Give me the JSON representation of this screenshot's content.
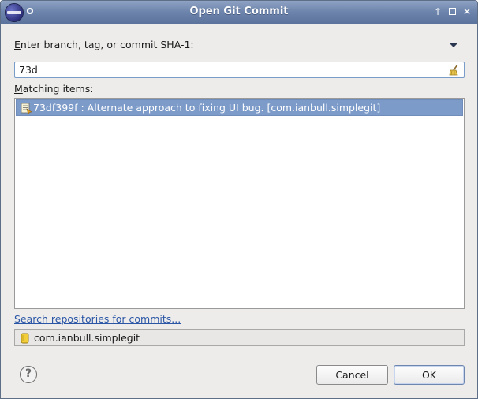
{
  "window": {
    "title": "Open Git Commit"
  },
  "prompt": {
    "prefix_underlined": "E",
    "rest": "nter branch, tag, or commit SHA-1:"
  },
  "search": {
    "value": "73d"
  },
  "matching": {
    "prefix_underlined": "M",
    "rest": "atching items:"
  },
  "results": [
    {
      "text": "73df399f : Alternate approach to fixing UI bug. [com.ianbull.simplegit]",
      "selected": true
    }
  ],
  "link": {
    "label": "Search repositories for commits..."
  },
  "status": {
    "repository": "com.ianbull.simplegit"
  },
  "buttons": {
    "cancel": "Cancel",
    "ok": "OK",
    "help": "?"
  },
  "icons": {
    "app": "eclipse-icon",
    "menu": "window-menu-icon",
    "minimize": "roll-up-icon",
    "maximize": "maximize-icon",
    "close": "close-icon",
    "history": "dropdown-arrow-icon",
    "clear": "clear-broom-icon",
    "commit": "commit-icon",
    "repo": "repository-icon"
  },
  "colors": {
    "titlebar": "#6c83ab",
    "selection": "#7d9bc9",
    "link": "#2b56a6"
  }
}
